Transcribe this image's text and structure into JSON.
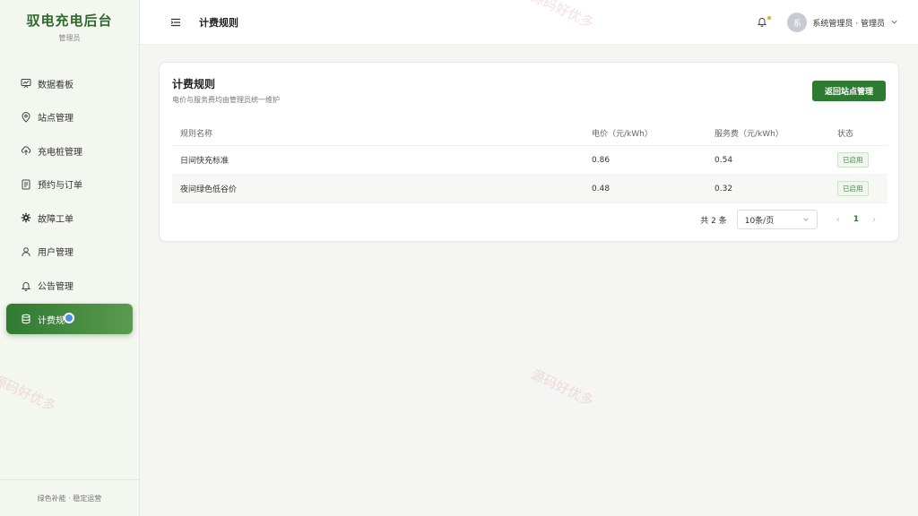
{
  "brand": {
    "title": "驭电充电后台",
    "subtitle": "管理员"
  },
  "menu": [
    {
      "label": "数据看板",
      "icon": "dashboard-icon",
      "active": false
    },
    {
      "label": "站点管理",
      "icon": "location-icon",
      "active": false
    },
    {
      "label": "充电桩管理",
      "icon": "cloud-upload-icon",
      "active": false
    },
    {
      "label": "预约与订单",
      "icon": "document-icon",
      "active": false
    },
    {
      "label": "故障工单",
      "icon": "gear-icon",
      "active": false
    },
    {
      "label": "用户管理",
      "icon": "user-icon",
      "active": false
    },
    {
      "label": "公告管理",
      "icon": "bell-icon",
      "active": false
    },
    {
      "label": "计费规",
      "icon": "database-icon",
      "active": true
    }
  ],
  "sidebar_footer": "绿色补能 · 稳定运营",
  "topbar": {
    "title": "计费规则",
    "avatar_text": "系",
    "user_label": "系统管理员 · 管理员"
  },
  "card": {
    "title": "计费规则",
    "subtitle": "电价与服务费均由管理员统一维护",
    "back_button": "返回站点管理"
  },
  "table": {
    "headers": [
      "规则名称",
      "电价（元/kWh）",
      "服务费（元/kWh）",
      "状态"
    ],
    "rows": [
      {
        "name": "日间快充标准",
        "price": "0.86",
        "service": "0.54",
        "status": "已启用"
      },
      {
        "name": "夜间绿色低谷价",
        "price": "0.48",
        "service": "0.32",
        "status": "已启用"
      }
    ]
  },
  "pager": {
    "total": "共 2 条",
    "page_size": "10条/页",
    "current_page": "1"
  },
  "watermark": "源码好优多",
  "colors": {
    "brand_green": "#2f7a32",
    "status_dot": "#e0b020"
  }
}
